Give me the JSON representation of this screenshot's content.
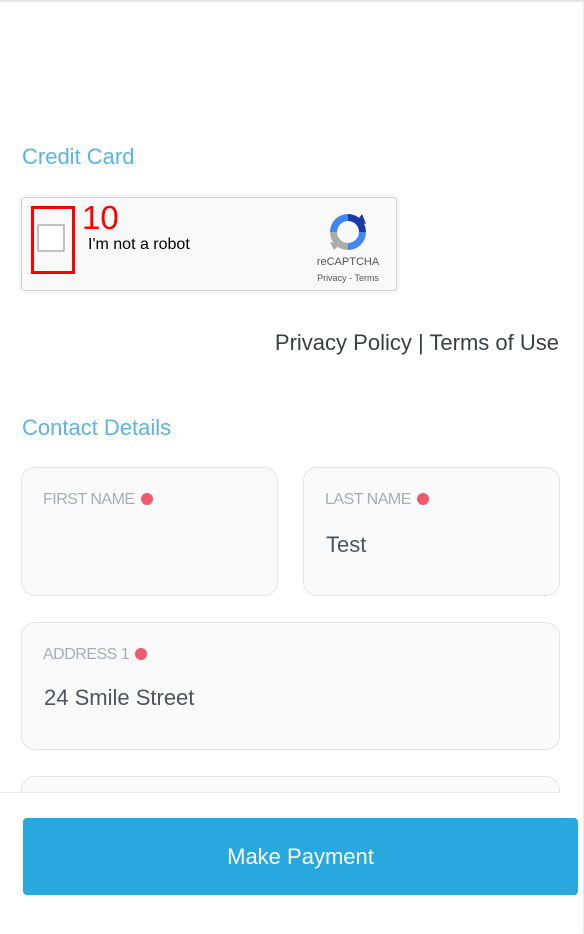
{
  "sections": {
    "credit_card_title": "Credit Card",
    "contact_details_title": "Contact Details"
  },
  "recaptcha": {
    "label": "I'm not a robot",
    "brand": "reCAPTCHA",
    "privacy_link": "Privacy",
    "separator": "-",
    "terms_link": "Terms",
    "checked": false
  },
  "annotation": {
    "mark_label": "10",
    "color": "#ff0000"
  },
  "policy": {
    "privacy_policy": "Privacy Policy",
    "divider": "|",
    "terms_of_use": "Terms of Use"
  },
  "contact_form": {
    "first_name": {
      "label": "FIRST NAME",
      "value": "",
      "required": true
    },
    "last_name": {
      "label": "LAST NAME",
      "value": "Test",
      "required": true
    },
    "address1": {
      "label": "ADDRESS 1",
      "value": "24 Smile Street",
      "required": true
    }
  },
  "actions": {
    "make_payment_label": "Make Payment"
  },
  "colors": {
    "accent": "#5bb4e2",
    "button": "#29a8e0",
    "required_dot": "#ef5a6f"
  }
}
